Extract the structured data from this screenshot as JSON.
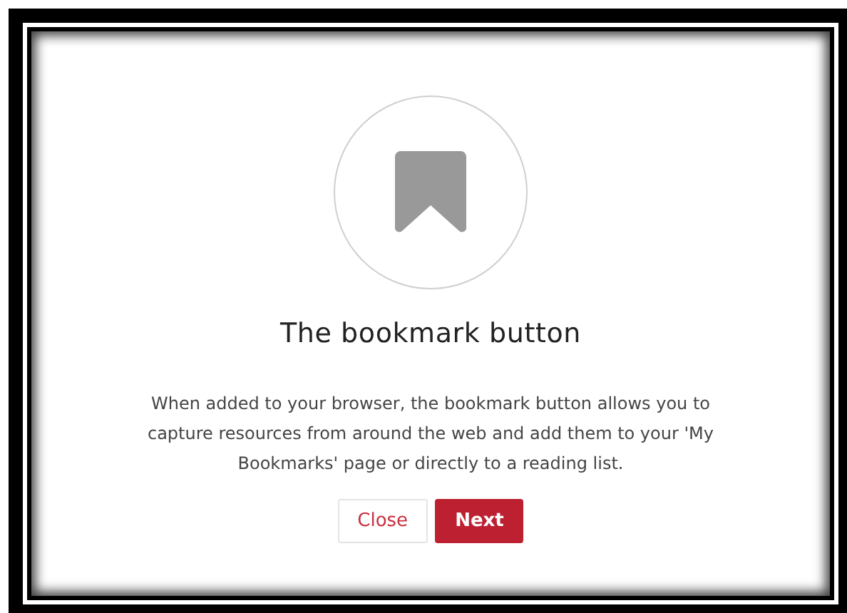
{
  "dialog": {
    "title": "The bookmark button",
    "description": "When added to your browser, the bookmark button allows you to capture resources from around the web and add them to your 'My Bookmarks' page or directly to a reading list.",
    "buttons": [
      {
        "label": "Close",
        "kind": "secondary"
      },
      {
        "label": "Next",
        "kind": "primary"
      }
    ]
  }
}
